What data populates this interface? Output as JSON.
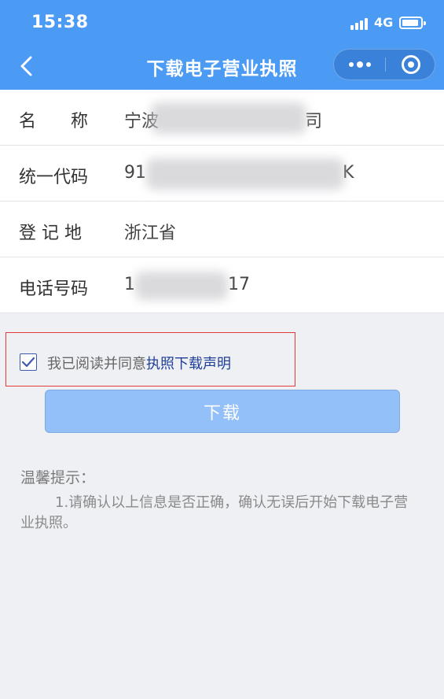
{
  "status_bar": {
    "time": "15:38",
    "network": "4G"
  },
  "nav": {
    "title": "下载电子营业执照",
    "icons": [
      "back-chevron-icon",
      "more-dots-icon",
      "close-target-icon"
    ]
  },
  "info": {
    "rows": [
      {
        "label": "名　　称",
        "value_start": "宁波",
        "value_end": "司"
      },
      {
        "label": "统一代码",
        "value_start": "91",
        "value_end": "K"
      },
      {
        "label": "登 记 地",
        "value_start": "浙江省",
        "value_end": ""
      },
      {
        "label": "电话号码",
        "value_start": "1",
        "value_end": "17"
      }
    ]
  },
  "agreement": {
    "checked": true,
    "text": "我已阅读并同意",
    "link": "执照下载声明"
  },
  "download_button": {
    "label": "下载"
  },
  "tips": {
    "title": "温馨提示：",
    "body": "1.请确认以上信息是否正确，确认无误后开始下载电子营业执照。"
  },
  "colors": {
    "header_bg": "#4b9bf5",
    "button_bg": "#93c0f8",
    "link": "#1f3f99",
    "highlight_border": "#e23a3a"
  }
}
